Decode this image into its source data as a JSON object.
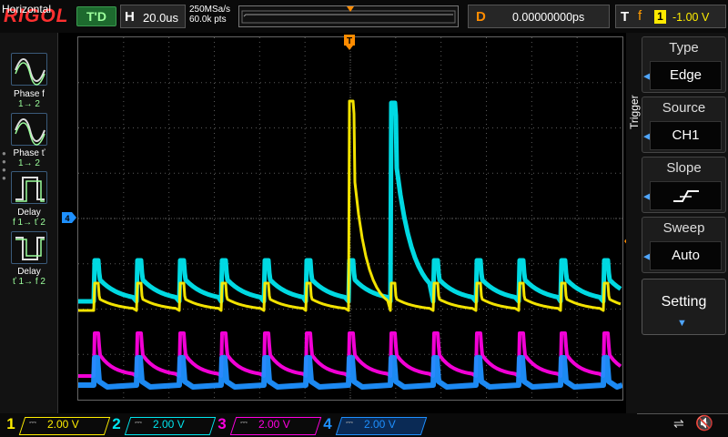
{
  "brand": "RIGOL",
  "status": "T'D",
  "horizontal": {
    "key": "H",
    "timebase": "20.0us",
    "sample_rate": "250MSa/s",
    "points": "60.0k pts"
  },
  "delay": {
    "key": "D",
    "value": "0.00000000ps"
  },
  "trigger_info": {
    "key": "T",
    "edge_symbol": "f",
    "source": "1",
    "level": "-1.00 V"
  },
  "left_menu": {
    "title": "Horizontal",
    "items": [
      {
        "label": "Phase",
        "sym": "f",
        "sub": "1→ 2"
      },
      {
        "label": "Phase",
        "sym": "ť",
        "sub": "1→ 2"
      },
      {
        "label": "Delay",
        "sub": "f 1→ ť 2"
      },
      {
        "label": "Delay",
        "sub": "ť 1→ f 2"
      }
    ]
  },
  "right_menu": {
    "title": "Trigger",
    "type": {
      "label": "Type",
      "value": "Edge"
    },
    "source": {
      "label": "Source",
      "value": "CH1"
    },
    "slope": {
      "label": "Slope",
      "value": "rising-edge-icon"
    },
    "sweep": {
      "label": "Sweep",
      "value": "Auto"
    },
    "setting": {
      "label": "Setting"
    }
  },
  "channels": [
    {
      "num": "1",
      "volts": "2.00 V",
      "color": "#ffee00"
    },
    {
      "num": "2",
      "volts": "2.00 V",
      "color": "#00e5ee"
    },
    {
      "num": "3",
      "volts": "2.00 V",
      "color": "#ff00e0"
    },
    {
      "num": "4",
      "volts": "2.00 V",
      "color": "#1e90ff"
    }
  ],
  "colors": {
    "grid": "#5a5a5a",
    "trigger_marker": "#ff8c00",
    "accent": "#4fa6ff"
  }
}
